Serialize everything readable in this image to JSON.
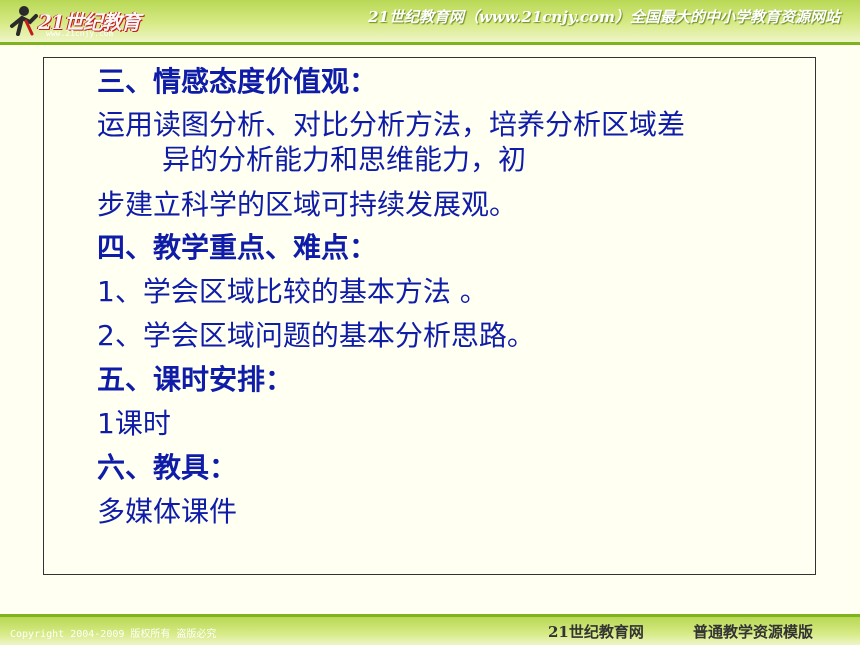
{
  "header": {
    "logo_text": "21世纪教育",
    "logo_url": "www.21cnjy.com",
    "tagline": "21世纪教育网（www.21cnjy.com）全国最大的中小学教育资源网站"
  },
  "content": {
    "lines": [
      {
        "text": "三、情感态度价值观：",
        "style": "heading"
      },
      {
        "text": "运用读图分析、对比分析方法，培养分析区域差",
        "style": "body"
      },
      {
        "text": "异的分析能力和思维能力，初",
        "style": "body"
      },
      {
        "text": "步建立科学的区域可持续发展观。",
        "style": "body"
      },
      {
        "text": "四、教学重点、难点：",
        "style": "heading"
      },
      {
        "text": "1、学会区域比较的基本方法 。",
        "style": "body"
      },
      {
        "text": "2、学会区域问题的基本分析思路。",
        "style": "body"
      },
      {
        "text": "五、课时安排：",
        "style": "heading"
      },
      {
        "text": "1课时",
        "style": "body"
      },
      {
        "text": "六、教具：",
        "style": "heading"
      },
      {
        "text": "多媒体课件",
        "style": "body"
      }
    ]
  },
  "footer": {
    "copyright": "Copyright 2004-2009 版权所有 盗版必究",
    "brand": "21世纪教育网",
    "template": "普通教学资源模版"
  },
  "colors": {
    "text": "#0e1ca8",
    "banner": "#b8d855",
    "banner_line": "#7fb21f"
  }
}
